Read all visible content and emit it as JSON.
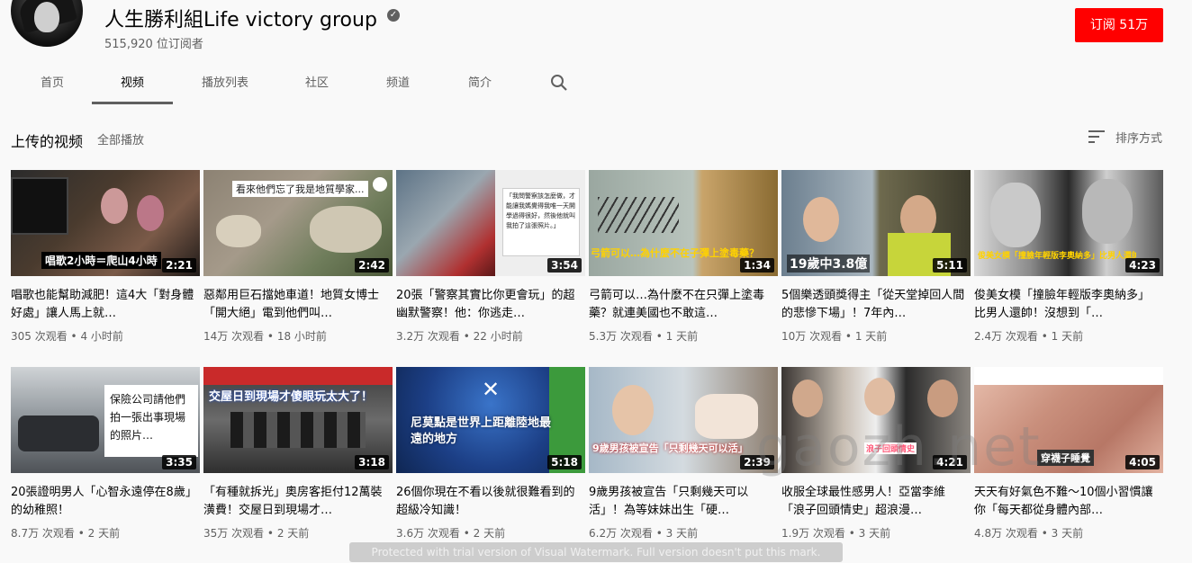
{
  "channel": {
    "name": "人生勝利組Life victory group",
    "verified_mark": "✓",
    "subscribers": "515,920 位订阅者",
    "subscribe_label": "订阅 51万"
  },
  "tabs": [
    {
      "label": "首页"
    },
    {
      "label": "视频"
    },
    {
      "label": "播放列表"
    },
    {
      "label": "社区"
    },
    {
      "label": "频道"
    },
    {
      "label": "简介"
    }
  ],
  "section": {
    "title": "上传的视频",
    "play_all": "全部播放",
    "sort_label": "排序方式"
  },
  "videos": [
    {
      "duration": "2:21",
      "title": "唱歌也能幫助減肥！這4大「對身體好處」讓人馬上就…",
      "views": "305 次观看",
      "age": "4 小时前",
      "thumb_text": "唱歌2小時＝爬山4小時"
    },
    {
      "duration": "2:42",
      "title": "惡鄰用巨石擋她車道！地質女博士「開大絕」電到他們叫…",
      "views": "14万 次观看",
      "age": "18 小时前",
      "thumb_text": "看來他們忘了我是地質學家..."
    },
    {
      "duration": "3:54",
      "title": "20張「警察其實比你更會玩」的超幽默警察！他：你逃走…",
      "views": "3.2万 次观看",
      "age": "22 小时前",
      "thumb_text": "「我問警察該怎麼做，才能讓我媽覺得我唯一天開學過得很好，然後他就叫我拍了這張照片。」"
    },
    {
      "duration": "1:34",
      "title": "弓箭可以…為什麼不在只彈上塗毒藥？就連美國也不敢這…",
      "views": "5.3万 次观看",
      "age": "1 天前",
      "thumb_text": "弓箭可以…為什麼不在子彈上塗毒藥？"
    },
    {
      "duration": "5:11",
      "title": "5個樂透頭獎得主「從天堂掉回人間的悲慘下場」！7年內…",
      "views": "10万 次观看",
      "age": "1 天前",
      "thumb_text": "19歲中3.8億"
    },
    {
      "duration": "4:23",
      "title": "俊美女模「撞臉年輕版李奧納多」比男人還帥！沒想到「…",
      "views": "2.4万 次观看",
      "age": "1 天前",
      "thumb_text": "俊美女模「撞臉年輕版李奧納多」比男人還帥！"
    },
    {
      "duration": "3:35",
      "title": "20張證明男人「心智永遠停在8歲」的幼稚照！",
      "views": "8.7万 次观看",
      "age": "2 天前",
      "thumb_text": "保險公司請他們拍一張出事現場的照片…"
    },
    {
      "duration": "3:18",
      "title": "「有種就拆光」奧房客拒付12萬裝潢費！交屋日到現場才…",
      "views": "35万 次观看",
      "age": "2 天前",
      "thumb_text": "交屋日到現場才傻眼玩太大了！"
    },
    {
      "duration": "5:18",
      "title": "26個你現在不看以後就很難看到的超級冷知識！",
      "views": "3.6万 次观看",
      "age": "2 天前",
      "thumb_text": "尼莫點是世界上距離陸地最遠的地方"
    },
    {
      "duration": "2:39",
      "title": "9歲男孩被宣告「只剩幾天可以活」！為等妹妹出生「硬…",
      "views": "6.2万 次观看",
      "age": "3 天前",
      "thumb_text": "9歲男孩被宣告「只剩幾天可以活」"
    },
    {
      "duration": "4:21",
      "title": "收服全球最性感男人！亞當李維「浪子回頭情史」超浪漫…",
      "views": "1.9万 次观看",
      "age": "3 天前",
      "thumb_text": "浪子回頭情史"
    },
    {
      "duration": "4:05",
      "title": "天天有好氣色不難～10個小習慣讓你「每天都從身體內部…",
      "views": "4.8万 次观看",
      "age": "3 天前",
      "thumb_text": "穿襪子睡覺"
    }
  ],
  "meta_separator": " • ",
  "watermark": "Protected with trial version of Visual Watermark. Full version doesn't put this mark.",
  "watermark_site": "gaozh.net",
  "colors": {
    "accent": "#ff0000",
    "text": "#030303",
    "secondary": "#606060",
    "background": "#f9f9f9"
  }
}
